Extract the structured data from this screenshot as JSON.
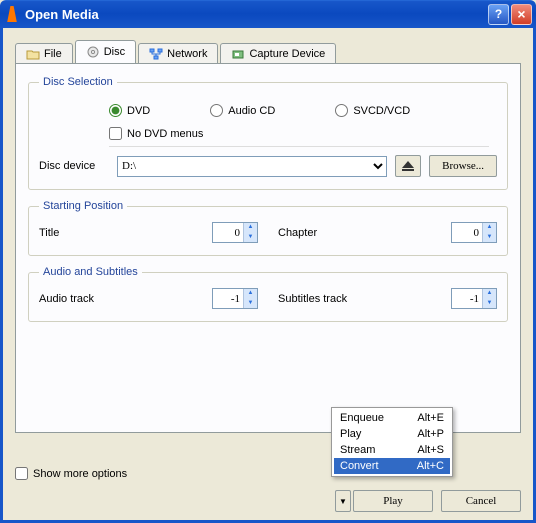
{
  "window": {
    "title": "Open Media"
  },
  "tabs": {
    "file": "File",
    "disc": "Disc",
    "network": "Network",
    "capture": "Capture Device"
  },
  "disc_selection": {
    "legend": "Disc Selection",
    "dvd": "DVD",
    "audio_cd": "Audio CD",
    "svcd": "SVCD/VCD",
    "no_menus": "No DVD menus",
    "device_label": "Disc device",
    "device_value": "D:\\",
    "browse": "Browse..."
  },
  "starting_position": {
    "legend": "Starting Position",
    "title_label": "Title",
    "title_value": "0",
    "chapter_label": "Chapter",
    "chapter_value": "0"
  },
  "audio_subs": {
    "legend": "Audio and Subtitles",
    "audio_label": "Audio track",
    "audio_value": "-1",
    "subs_label": "Subtitles track",
    "subs_value": "-1"
  },
  "show_more": "Show more options",
  "buttons": {
    "play": "Play",
    "cancel": "Cancel"
  },
  "menu": {
    "enqueue": {
      "label": "Enqueue",
      "shortcut": "Alt+E"
    },
    "play": {
      "label": "Play",
      "shortcut": "Alt+P"
    },
    "stream": {
      "label": "Stream",
      "shortcut": "Alt+S"
    },
    "convert": {
      "label": "Convert",
      "shortcut": "Alt+C"
    }
  }
}
